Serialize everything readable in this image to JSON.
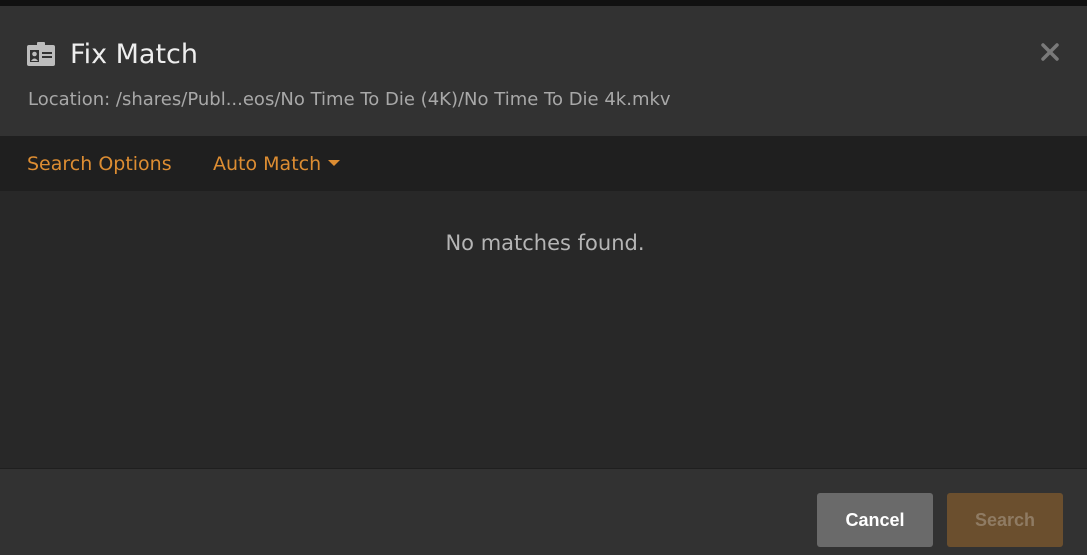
{
  "dialog": {
    "title": "Fix Match",
    "title_icon": "id-card-icon",
    "location": "Location: /shares/Publ...eos/No Time To Die (4K)/No Time To Die 4k.mkv",
    "close_icon": "close-icon"
  },
  "options_bar": {
    "search_options_label": "Search Options",
    "auto_match_label": "Auto Match",
    "auto_match_icon": "caret-down-icon"
  },
  "results": {
    "empty_message": "No matches found."
  },
  "footer": {
    "cancel_label": "Cancel",
    "search_label": "Search"
  },
  "colors": {
    "accent": "#dd8d32",
    "header_bg": "#323232",
    "body_bg": "#282828",
    "bar_bg": "#1f1f1f",
    "cancel_bg": "#6a6a6a",
    "search_bg_disabled": "#6b4f2e"
  }
}
